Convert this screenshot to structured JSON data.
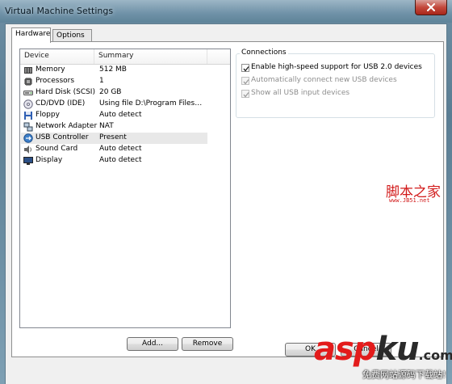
{
  "window": {
    "title": "Virtual Machine Settings"
  },
  "tabs": [
    {
      "label": "Hardware",
      "active": true
    },
    {
      "label": "Options",
      "active": false
    }
  ],
  "device_list": {
    "columns": [
      "Device",
      "Summary"
    ],
    "rows": [
      {
        "icon": "memory-icon",
        "device": "Memory",
        "summary": "512 MB",
        "selected": false
      },
      {
        "icon": "processor-icon",
        "device": "Processors",
        "summary": "1",
        "selected": false
      },
      {
        "icon": "hard-disk-icon",
        "device": "Hard Disk (SCSI)",
        "summary": "20 GB",
        "selected": false
      },
      {
        "icon": "cd-dvd-icon",
        "device": "CD/DVD (IDE)",
        "summary": "Using file D:\\Program Files\\v...",
        "selected": false
      },
      {
        "icon": "floppy-icon",
        "device": "Floppy",
        "summary": "Auto detect",
        "selected": false
      },
      {
        "icon": "network-adapter-icon",
        "device": "Network Adapter",
        "summary": "NAT",
        "selected": false
      },
      {
        "icon": "usb-icon",
        "device": "USB Controller",
        "summary": "Present",
        "selected": true
      },
      {
        "icon": "sound-card-icon",
        "device": "Sound Card",
        "summary": "Auto detect",
        "selected": false
      },
      {
        "icon": "display-icon",
        "device": "Display",
        "summary": "Auto detect",
        "selected": false
      }
    ]
  },
  "list_buttons": {
    "add": "Add...",
    "remove": "Remove"
  },
  "connections": {
    "label": "Connections",
    "options": [
      {
        "label": "Enable high-speed support for USB 2.0 devices",
        "checked": true,
        "enabled": true
      },
      {
        "label": "Automatically connect new USB devices",
        "checked": true,
        "enabled": false
      },
      {
        "label": "Show all USB input devices",
        "checked": true,
        "enabled": false
      }
    ]
  },
  "dialog_buttons": {
    "ok": "OK",
    "cancel": "Cancel"
  },
  "watermarks": {
    "site_cn": "脚本之家",
    "site_url": "www.JB51.net",
    "brand_a": "asp",
    "brand_b": "ku",
    "brand_suffix": ".com",
    "brand_sub": "免费网站源码下载站!"
  },
  "colors": {
    "selection_bg": "#e8e8e8",
    "watermark_red": "#d21b1b",
    "close_button": "#c4493c"
  }
}
